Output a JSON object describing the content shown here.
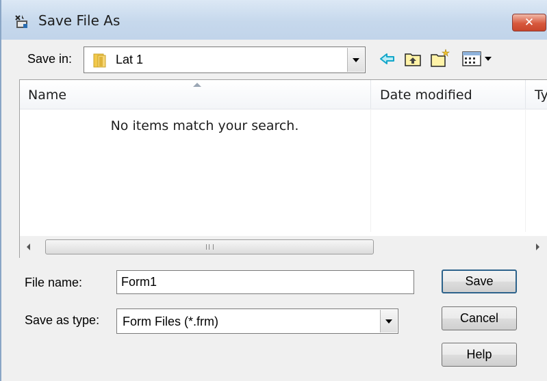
{
  "window": {
    "title": "Save File As",
    "close_label": "✕"
  },
  "save_in": {
    "label": "Save in:",
    "value": "Lat 1"
  },
  "toolbar": {
    "icons": [
      "back-arrow-icon",
      "up-folder-icon",
      "new-folder-icon",
      "view-menu-icon"
    ]
  },
  "list": {
    "columns": [
      "Name",
      "Date modified",
      "Ty"
    ],
    "empty_message": "No items match your search.",
    "scroll_grip": "III"
  },
  "file_name": {
    "label": "File name:",
    "value": "Form1"
  },
  "save_as_type": {
    "label": "Save as type:",
    "value": "Form Files (*.frm)"
  },
  "buttons": {
    "save": "Save",
    "cancel": "Cancel",
    "help": "Help"
  },
  "colors": {
    "titlebar": "#c6d8ec",
    "close": "#d8593d",
    "toolbar_accent": "#12a6c9"
  }
}
